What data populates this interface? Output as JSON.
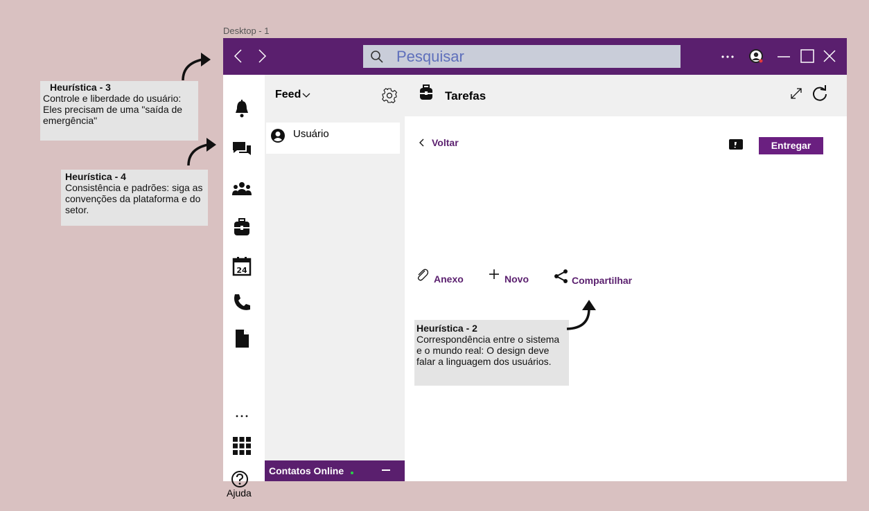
{
  "frame": {
    "label": "Desktop - 1"
  },
  "titlebar": {
    "search_placeholder": "Pesquisar",
    "colors": {
      "titlebar": "#5a1f6e",
      "search_bg": "#c9cdd9",
      "search_text": "#5e6fbb"
    }
  },
  "rail": {
    "items": [
      {
        "icon": "bell-icon"
      },
      {
        "icon": "chat-icon"
      },
      {
        "icon": "teams-icon"
      },
      {
        "icon": "backpack-icon"
      },
      {
        "icon": "calendar-icon"
      },
      {
        "icon": "phone-icon"
      },
      {
        "icon": "file-icon"
      },
      {
        "icon": "more-icon"
      },
      {
        "icon": "apps-grid-icon"
      }
    ],
    "help_label": "Ajuda"
  },
  "feed": {
    "title": "Feed",
    "user_label": "Usuário",
    "online_label": "Contatos Online",
    "colors": {
      "online_dot": "#2ad14a"
    }
  },
  "content": {
    "title": "Tarefas",
    "back_label": "Voltar",
    "submit_label": "Entregar",
    "actions": {
      "attach": "Anexo",
      "new": "Novo",
      "share": "Compartilhar"
    },
    "colors": {
      "accent": "#6a1f80"
    }
  },
  "notes": {
    "h3": {
      "title": "Heurística  - 3",
      "body": "Controle e liberdade do usuário: Eles precisam de uma \"saída de emergência\""
    },
    "h4": {
      "title": "Heurística  - 4",
      "body": "Consistência e padrões: siga as convenções da plataforma e do setor."
    },
    "h2": {
      "title": "Heurística  -  2",
      "body": "Correspondência entre o sistema e o mundo real: O design deve falar a linguagem dos usuários."
    }
  }
}
